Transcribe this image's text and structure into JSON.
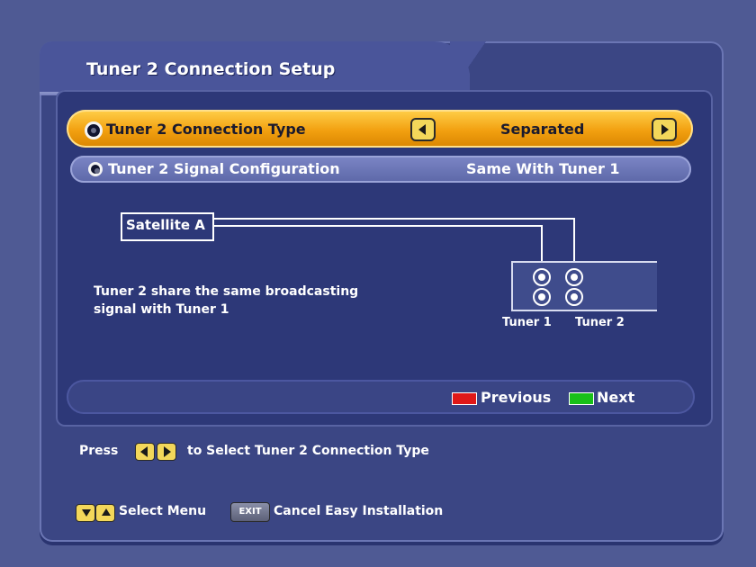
{
  "window": {
    "title": "Tuner 2 Connection Setup"
  },
  "settings": {
    "connection_type": {
      "label": "Tuner 2 Connection Type",
      "value": "Separated"
    },
    "signal_config": {
      "label": "Tuner 2 Signal Configuration",
      "value": "Same With Tuner 1"
    }
  },
  "diagram": {
    "satellite_label": "Satellite A",
    "description_line1": "Tuner 2 share the same broadcasting",
    "description_line2": "signal with Tuner 1",
    "tuner1_label": "Tuner 1",
    "tuner2_label": "Tuner 2"
  },
  "nav": {
    "previous_label": "Previous",
    "next_label": "Next",
    "previous_color": "#e01818",
    "next_color": "#18c018"
  },
  "hints": {
    "press": "Press",
    "select_type": "to Select Tuner 2 Connection Type",
    "select_menu": "Select Menu",
    "exit_key": "EXIT",
    "cancel": "Cancel Easy Installation"
  },
  "colors": {
    "highlight": "#f2a010",
    "panel": "#2d3878"
  }
}
